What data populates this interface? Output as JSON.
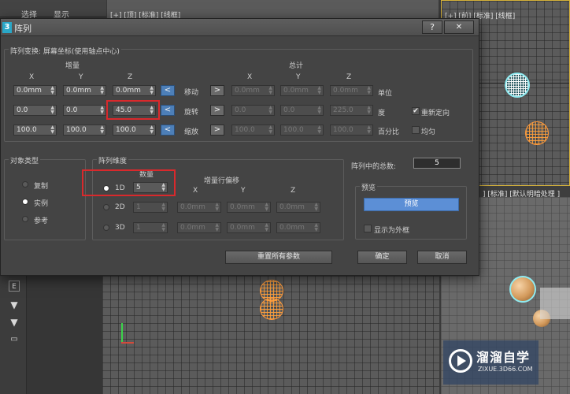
{
  "background": {
    "topmenu": [
      "选择",
      "显示"
    ],
    "viewport_labels": {
      "top_left": "[+] [顶] [标准] [线框]",
      "top_right": "[+] [前] [标准] [线框]",
      "right_mid": "] [标准] [默认明暗处理 ]"
    }
  },
  "watermark": {
    "title": "溜溜自学",
    "subtitle": "ZIXUE.3D66.COM"
  },
  "dialog": {
    "title": "阵列",
    "help_button": "?",
    "close_button": "✕",
    "transform": {
      "group_label": "阵列变换: 屏幕坐标(使用轴点中心)",
      "increment_label": "增量",
      "total_label": "总计",
      "axis_x": "X",
      "axis_y": "Y",
      "axis_z": "Z",
      "rows": [
        {
          "label": "移动",
          "increment": [
            "0.0mm",
            "0.0mm",
            "0.0mm"
          ],
          "total": [
            "0.0mm",
            "0.0mm",
            "0.0mm"
          ],
          "unit": "单位"
        },
        {
          "label": "旋转",
          "increment": [
            "0.0",
            "0.0",
            "45.0"
          ],
          "total": [
            "0.0",
            "0.0",
            "225.0"
          ],
          "unit": "度"
        },
        {
          "label": "缩放",
          "increment": [
            "100.0",
            "100.0",
            "100.0"
          ],
          "total": [
            "100.0",
            "100.0",
            "100.0"
          ],
          "unit": "百分比"
        }
      ],
      "arrow_left": "<",
      "arrow_right": ">",
      "reorient_label": "重新定向",
      "reorient_checked": true,
      "uniform_label": "均匀",
      "uniform_checked": false
    },
    "object_type": {
      "group_label": "对象类型",
      "options": [
        "复制",
        "实例",
        "参考"
      ],
      "selected": "实例"
    },
    "array_dimensions": {
      "group_label": "阵列维度",
      "count_label": "数量",
      "row_offset_label": "增量行偏移",
      "axis_x": "X",
      "axis_y": "Y",
      "axis_z": "Z",
      "rows": [
        {
          "label": "1D",
          "count": "5",
          "offsets": []
        },
        {
          "label": "2D",
          "count": "1",
          "offsets": [
            "0.0mm",
            "0.0mm",
            "0.0mm"
          ]
        },
        {
          "label": "3D",
          "count": "1",
          "offsets": [
            "0.0mm",
            "0.0mm",
            "0.0mm"
          ]
        }
      ],
      "selected": "1D"
    },
    "total_in_array": {
      "label": "阵列中的总数:",
      "value": "5"
    },
    "preview": {
      "group_label": "预览",
      "preview_button": "预览",
      "show_as_box_label": "显示为外框",
      "show_as_box_checked": false
    },
    "reset_button": "重置所有参数",
    "ok_button": "确定",
    "cancel_button": "取消"
  },
  "colors": {
    "accent_blue": "#5c8fd6",
    "highlight_red": "#d9292c",
    "viewport_active": "#d6b23a"
  }
}
